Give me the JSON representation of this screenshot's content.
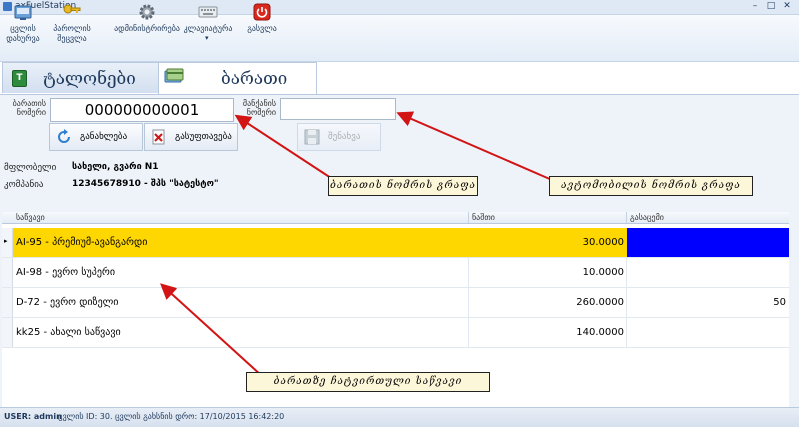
{
  "window": {
    "title": "axFuelStation",
    "minimize": "–",
    "maximize": "□",
    "close": "✕"
  },
  "toolbar": {
    "items": [
      {
        "label": "ცვლის\nდახურვა",
        "icon": "shift-close-icon"
      },
      {
        "label": "პაროლის\nშეცვლა",
        "icon": "key-icon"
      },
      {
        "label": "ადმინისტრირება",
        "icon": "gear-icon"
      },
      {
        "label": "კლავიატურა",
        "sub": "▾",
        "icon": "keyboard-icon"
      },
      {
        "label": "გასვლა",
        "icon": "power-icon"
      }
    ]
  },
  "tabs": [
    {
      "label": "ტალონები",
      "badge": "T"
    },
    {
      "label": "ბარათი"
    }
  ],
  "form": {
    "card_label": "ბარათის\nნომერი",
    "card_value": "000000000001",
    "car_label": "მანქანის\nნომერი",
    "car_value": "",
    "refresh_label": "განახლება",
    "clear_label": "გასუფთავება",
    "save_label": "შენახვა",
    "owner_label": "მფლობელი",
    "owner_value": "სახელი, გვარი N1",
    "company_label": "კომპანია",
    "company_value": "12345678910 - შპს \"სატესტო\""
  },
  "grid": {
    "headers": [
      "საწვავი",
      "ნაშთი",
      "გასაცემი"
    ],
    "rows": [
      {
        "fuel": "AI-95 - პრემიუმ-ავანგარდი",
        "balance": "30.0000",
        "issue": "",
        "selected": true
      },
      {
        "fuel": "AI-98 - ევრო სუპერი",
        "balance": "10.0000",
        "issue": ""
      },
      {
        "fuel": "D-72 - ევრო დიზელი",
        "balance": "260.0000",
        "issue": "50"
      },
      {
        "fuel": "kk25 - ახალი საწვავი",
        "balance": "140.0000",
        "issue": ""
      }
    ]
  },
  "callouts": {
    "card": "ბარათის ნომრის გრაფა",
    "car": "ავტომობილის ნომრის გრაფა",
    "fuel": "ბარათზე ჩატვირთული საწვავი"
  },
  "status": {
    "user": "USER: admin",
    "shift": "ცვლის ID: 30. ცვლის გახსნის დრო: 17/10/2015 16:42:20"
  },
  "colors": {
    "selected_row": "#ffd700",
    "selected_cell": "#0000ff",
    "arrow": "#d21414"
  }
}
